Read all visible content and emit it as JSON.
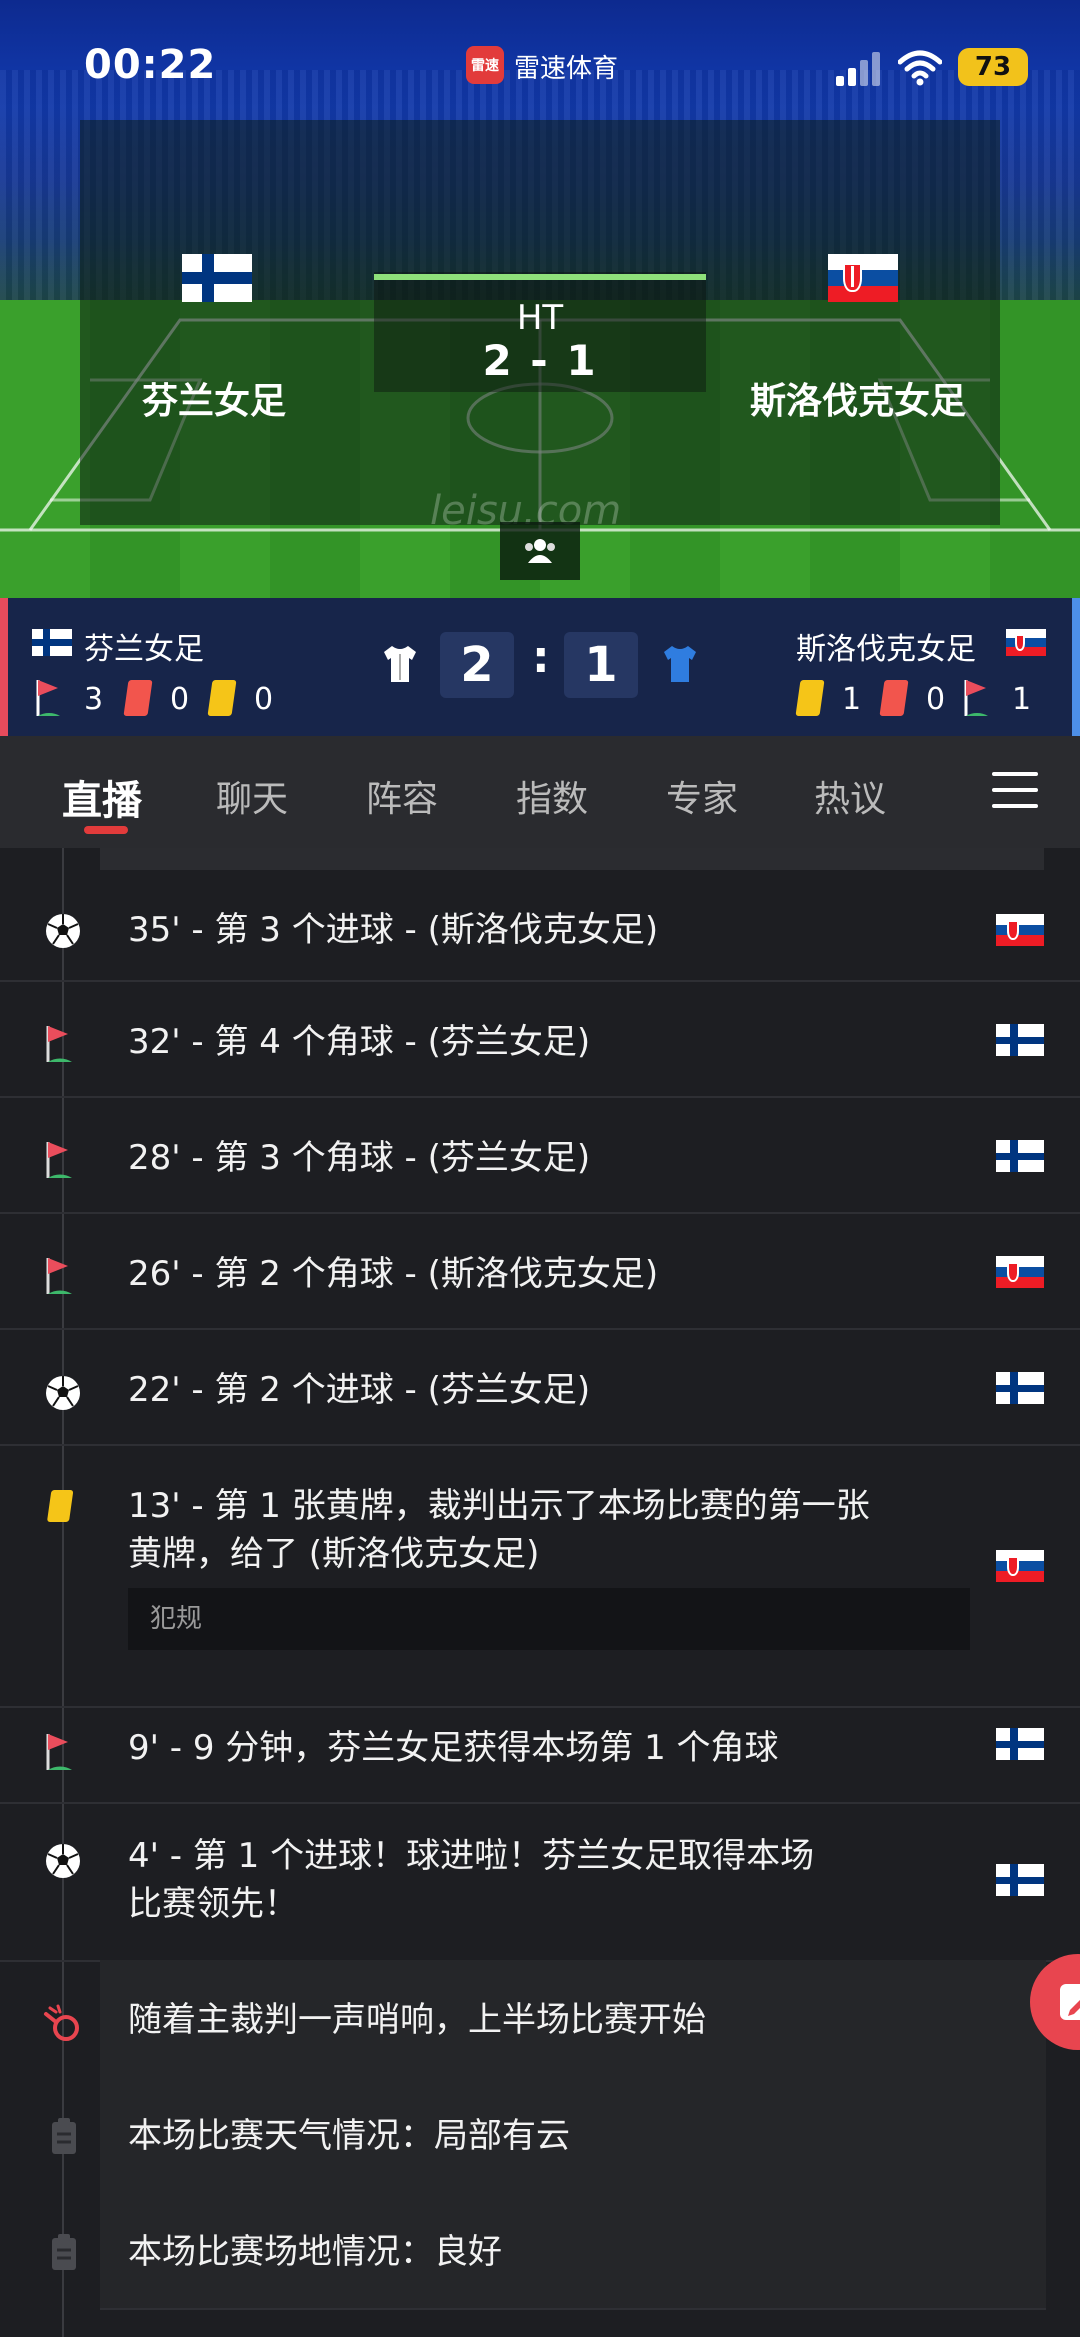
{
  "status_bar": {
    "time": "00:22",
    "app_badge": "雷速",
    "app_name": "雷速体育",
    "battery": "73"
  },
  "hero": {
    "home_team": "芬兰女足",
    "away_team": "斯洛伐克女足",
    "status": "HT",
    "score": "2 - 1",
    "watermark": "leisu.com",
    "lineup_icon": "people-icon"
  },
  "scoreboard": {
    "home": {
      "name": "芬兰女足",
      "corners": "3",
      "red": "0",
      "yellow": "0",
      "score": "2"
    },
    "away": {
      "name": "斯洛伐克女足",
      "corners": "1",
      "red": "0",
      "yellow": "1",
      "score": "1"
    },
    "separator": ":",
    "colors": {
      "home_accent": "#e74b5c",
      "away_accent": "#4d8fe8",
      "home_kit": "#ffffff",
      "away_kit": "#2f7de0"
    }
  },
  "tabs": [
    {
      "label": "直播",
      "active": true
    },
    {
      "label": "聊天"
    },
    {
      "label": "阵容"
    },
    {
      "label": "指数"
    },
    {
      "label": "专家"
    },
    {
      "label": "热议"
    }
  ],
  "events": [
    {
      "icon": "goal-icon",
      "text": "35' - 第 3 个进球 - (斯洛伐克女足)",
      "flag": "slovakia"
    },
    {
      "icon": "corner-flag-icon",
      "text": "32' - 第 4 个角球 - (芬兰女足)",
      "flag": "finland"
    },
    {
      "icon": "corner-flag-icon",
      "text": "28' - 第 3 个角球 - (芬兰女足)",
      "flag": "finland"
    },
    {
      "icon": "corner-flag-icon",
      "text": "26' - 第 2 个角球 - (斯洛伐克女足)",
      "flag": "slovakia"
    },
    {
      "icon": "goal-icon",
      "text": "22' - 第 2 个进球 - (芬兰女足)",
      "flag": "finland"
    },
    {
      "icon": "yellow-card-icon",
      "text_line1": "13' - 第 1 张黄牌，裁判出示了本场比赛的第一张",
      "text_line2": "黄牌，给了 (斯洛伐克女足)",
      "sub": "犯规",
      "flag": "slovakia"
    },
    {
      "icon": "corner-flag-icon",
      "text": "9' - 9 分钟，芬兰女足获得本场第 1 个角球",
      "flag": "finland"
    },
    {
      "icon": "goal-icon",
      "text_line1": "4' - 第 1 个进球！球进啦！芬兰女足取得本场",
      "text_line2": "比赛领先！",
      "flag": "finland"
    },
    {
      "icon": "whistle-icon",
      "text": "随着主裁判一声哨响，上半场比赛开始"
    },
    {
      "icon": "clipboard-icon",
      "text": "本场比赛天气情况：局部有云"
    },
    {
      "icon": "clipboard-icon",
      "text": "本场比赛场地情况：良好"
    }
  ]
}
